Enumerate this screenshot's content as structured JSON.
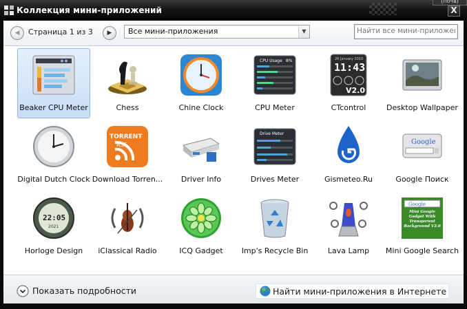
{
  "window": {
    "title": "Коллекция мини-приложений",
    "close_glyph": "X",
    "corner_tab": "(почв)"
  },
  "toolbar": {
    "page_label": "Страница 1 из 3",
    "prev_icon": "chevron-left-icon",
    "next_icon": "chevron-right-icon",
    "filter_value": "Все мини-приложения",
    "search_placeholder": "Найти все мини-приложения"
  },
  "gadgets": [
    {
      "name": "Beaker CPU Meter",
      "icon": "beaker-cpu-meter-icon",
      "selected": true
    },
    {
      "name": "Chess",
      "icon": "chess-icon",
      "selected": false
    },
    {
      "name": "Chine Clock",
      "icon": "chine-clock-icon",
      "selected": false
    },
    {
      "name": "CPU Meter",
      "icon": "cpu-meter-icon",
      "selected": false
    },
    {
      "name": "CTcontrol",
      "icon": "ctcontrol-icon",
      "selected": false
    },
    {
      "name": "Desktop Wallpaper",
      "icon": "desktop-wallpaper-icon",
      "selected": false
    },
    {
      "name": "Digital Dutch Clock",
      "icon": "digital-dutch-clock-icon",
      "selected": false
    },
    {
      "name": "Download Torren...",
      "icon": "download-torrent-icon",
      "selected": false
    },
    {
      "name": "Driver Info",
      "icon": "driver-info-icon",
      "selected": false
    },
    {
      "name": "Drives Meter",
      "icon": "drives-meter-icon",
      "selected": false
    },
    {
      "name": "Gismeteo.Ru",
      "icon": "gismeteo-icon",
      "selected": false
    },
    {
      "name": "Google Поиск",
      "icon": "google-search-icon",
      "selected": false
    },
    {
      "name": "Horloge Design",
      "icon": "horloge-design-icon",
      "selected": false
    },
    {
      "name": "iClassical Radio",
      "icon": "iclassical-radio-icon",
      "selected": false
    },
    {
      "name": "ICQ Gadget",
      "icon": "icq-gadget-icon",
      "selected": false
    },
    {
      "name": "Imp's Recycle Bin",
      "icon": "recycle-bin-icon",
      "selected": false
    },
    {
      "name": "Lava Lamp",
      "icon": "lava-lamp-icon",
      "selected": false
    },
    {
      "name": "Mini Google Search",
      "icon": "mini-google-search-icon",
      "selected": false
    }
  ],
  "icon_text": {
    "cpu_title": "CPU Usage",
    "cpu_percent": "8%",
    "ct_date": "26 January 2010",
    "ct_time": "11:43",
    "ct_version": "V2.0",
    "drive_title": "Drive Meter",
    "torrent_word": "TORRENT",
    "torrent_sub": "RSS",
    "horloge_time": "22:05",
    "horloge_year": "2021",
    "google_word": "Google",
    "mini_google_text": "Mini Google Gadget With Transparent Background V2.0"
  },
  "footer": {
    "details_label": "Показать подробности",
    "details_icon": "chevron-down-circle-icon",
    "online_label": "Найти мини-приложения в Интернете",
    "online_icon": "globe-icon"
  },
  "colors": {
    "titlebar": "#0b0b0b",
    "selection": "#c8def6",
    "selection_border": "#8fb6e0",
    "text": "#111111"
  }
}
